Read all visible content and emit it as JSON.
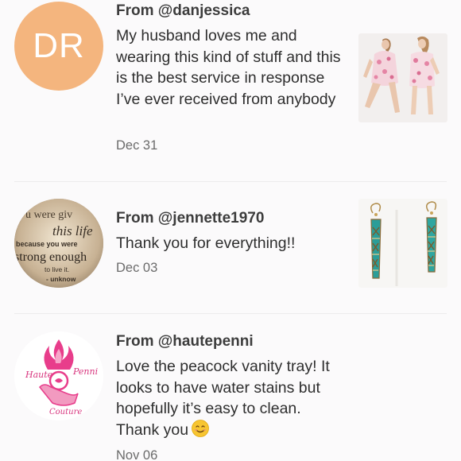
{
  "reviews": [
    {
      "from": "From @danjessica",
      "avatar_initials": "DR",
      "avatar_color": "#f4b57e",
      "text": "My husband loves me and wearing this kind of stuff and this is the best service in response I’ve ever received from anybody",
      "date": "Dec 31",
      "thumbnail": "pink-floral-rompers-photo"
    },
    {
      "from": "From @jennette1970",
      "avatar_image": "quote-graphic-avatar",
      "avatar_quote_lines": [
        "u were giv",
        "this life",
        "because you were",
        "strong enough",
        "to live it.",
        "- unknow"
      ],
      "text": "Thank you for everything!!",
      "date": "Dec 03",
      "thumbnail": "turquoise-earrings-photo"
    },
    {
      "from": "From @hautepenni",
      "avatar_image": "haute-penni-couture-logo",
      "avatar_logo_text": [
        "Haute",
        "Penni",
        "Couture"
      ],
      "text": "Love the peacock vanity tray! It looks to have water stains but hopefully it’s easy to clean. Thank you",
      "text_emoji": "smiling-face-emoji",
      "date": "Nov 06"
    }
  ]
}
